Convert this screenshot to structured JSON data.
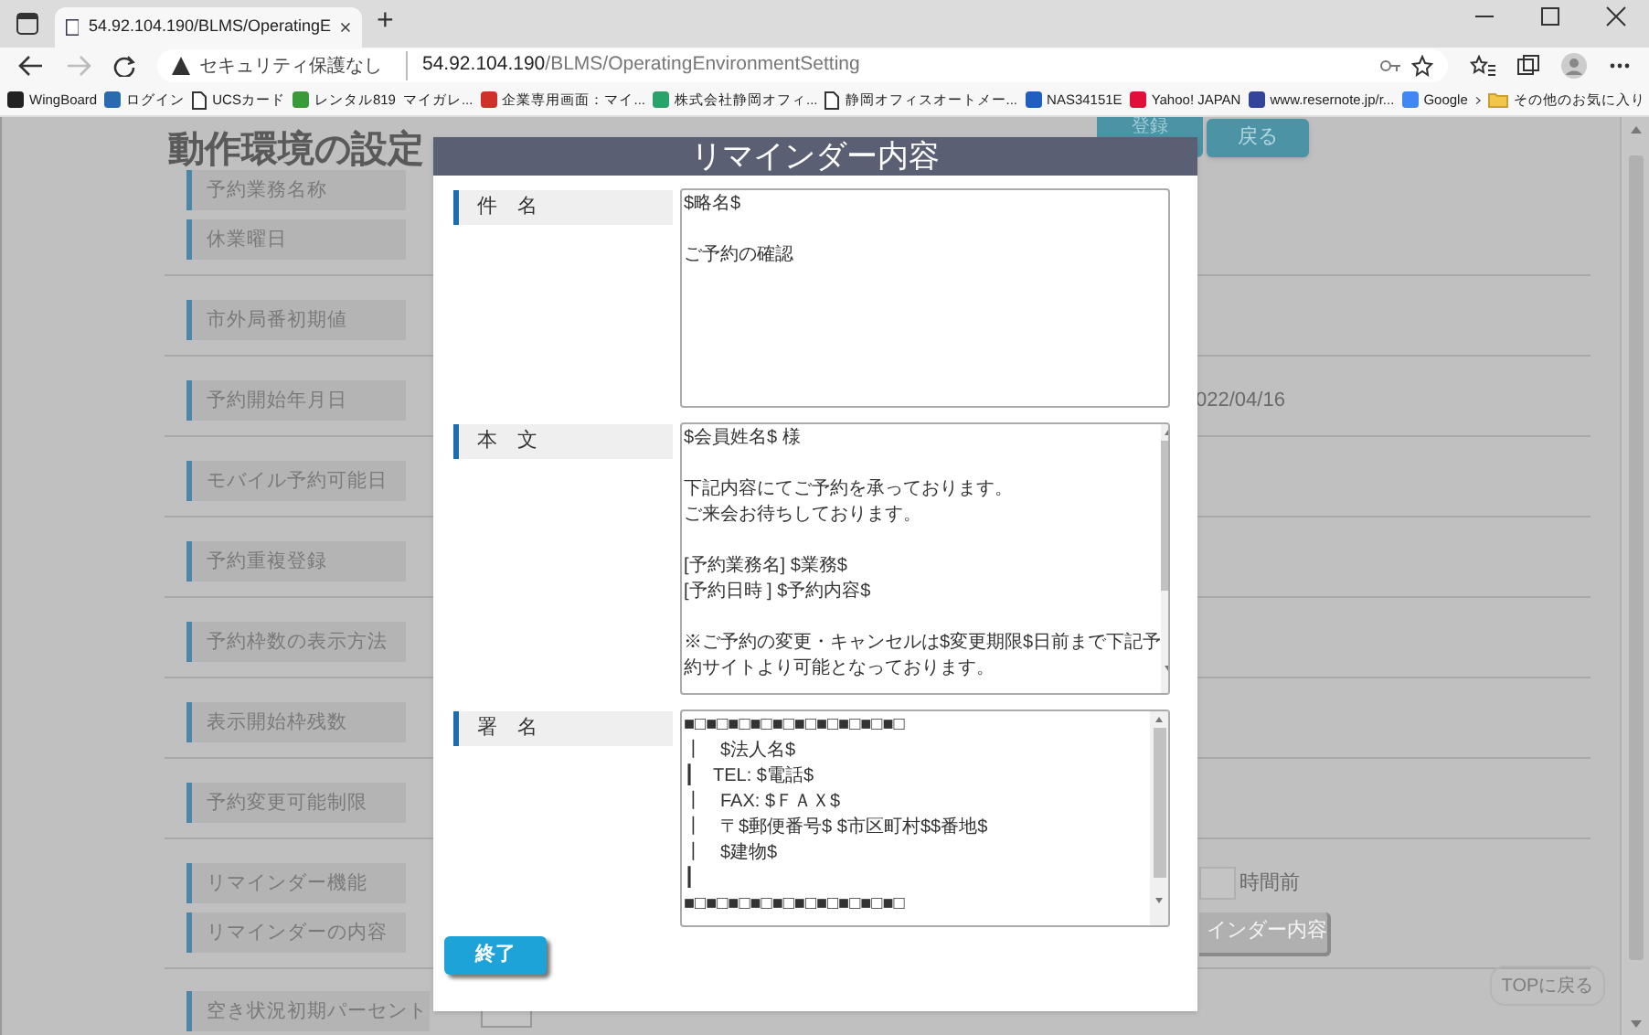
{
  "browser": {
    "tab_title": "54.92.104.190/BLMS/OperatingE",
    "new_tab": "+",
    "security": "セキュリティ保護なし",
    "url_host": "54.92.104.190",
    "url_path": "/BLMS/OperatingEnvironmentSetting",
    "bookmarks": [
      {
        "label": "WingBoard",
        "kind": "tile",
        "color": "#222222"
      },
      {
        "label": "ログイン",
        "kind": "tile",
        "color": "#2a6bb0"
      },
      {
        "label": "UCSカード",
        "kind": "page"
      },
      {
        "label": "レンタル819",
        "kind": "tile",
        "color": "#3a9a3a"
      },
      {
        "label": "マイガレ...",
        "kind": "none"
      },
      {
        "label": "企業専用画面：マイ...",
        "kind": "tile",
        "color": "#d0302a"
      },
      {
        "label": "株式会社静岡オフィ...",
        "kind": "tile",
        "color": "#2aa36a"
      },
      {
        "label": "静岡オフィスオートメー...",
        "kind": "page"
      },
      {
        "label": "NAS34151E",
        "kind": "tile",
        "color": "#1f5fc0"
      },
      {
        "label": "Yahoo! JAPAN",
        "kind": "tile",
        "color": "#e0103a"
      },
      {
        "label": "www.resernote.jp/r...",
        "kind": "tile",
        "color": "#334499"
      },
      {
        "label": "Google",
        "kind": "tile",
        "color": "#4285f4"
      }
    ],
    "other_bookmarks": "その他のお気に入り"
  },
  "page": {
    "title": "動作環境の設定",
    "buttons": [
      "登録",
      "戻る"
    ],
    "groups": [
      {
        "rows": [
          {
            "label": "予約業務名称",
            "kind": "plain"
          },
          {
            "label": "休業曜日",
            "kind": "plain"
          }
        ]
      },
      {
        "rows": [
          {
            "label": "市外局番初期値",
            "kind": "plain"
          }
        ]
      },
      {
        "rows": [
          {
            "label": "予約開始年月日",
            "kind": "date",
            "value": "022/04/16"
          }
        ]
      },
      {
        "rows": [
          {
            "label": "モバイル予約可能日",
            "kind": "plain"
          }
        ]
      },
      {
        "rows": [
          {
            "label": "予約重複登録",
            "kind": "plain"
          }
        ]
      },
      {
        "rows": [
          {
            "label": "予約枠数の表示方法",
            "kind": "plain"
          }
        ]
      },
      {
        "rows": [
          {
            "label": "表示開始枠残数",
            "kind": "plain"
          }
        ]
      },
      {
        "rows": [
          {
            "label": "予約変更可能制限",
            "kind": "plain"
          }
        ]
      },
      {
        "rows": [
          {
            "label": "リマインダー機能",
            "kind": "number_field",
            "suffix": "時間前"
          },
          {
            "label": "リマインダーの内容",
            "kind": "button",
            "button": "インダー内容"
          }
        ]
      },
      {
        "rows": [
          {
            "label": "空き状況初期パーセント",
            "kind": "percent_field"
          }
        ]
      }
    ],
    "top_button": "TOPに戻る"
  },
  "modal": {
    "title": "リマインダー内容",
    "fields": [
      {
        "label": "件　名",
        "scrollable": false,
        "lines": [
          {
            "text": "$略名$",
            "gap_before": false
          },
          {
            "text": "ご予約の確認",
            "gap_before": true
          }
        ]
      },
      {
        "label": "本　文",
        "scrollable": true,
        "lines": [
          {
            "text": "$会員姓名$ 様",
            "gap_before": false
          },
          {
            "text": "下記内容にてご予約を承っております。",
            "gap_before": true
          },
          {
            "text": "ご来会お待ちしております。",
            "gap_before": false
          },
          {
            "text": "[予約業務名] $業務$",
            "gap_before": true
          },
          {
            "text": "[予約日時 ] $予約内容$",
            "gap_before": false
          },
          {
            "text": "※ご予約の変更・キャンセルは$変更期限$日前まで下記予",
            "gap_before": true
          },
          {
            "text": "約サイトより可能となっております。",
            "gap_before": false
          }
        ]
      },
      {
        "label": "署　名",
        "scrollable": true,
        "lines": [
          {
            "text": "■□■□■□■□■□■□■□■□■□■□",
            "gap_before": false
          },
          {
            "text": "┃　$法人名$",
            "gap_before": false
          },
          {
            "text": "┃　TEL: $電話$",
            "gap_before": false
          },
          {
            "text": "┃　FAX: $ＦＡＸ$",
            "gap_before": false
          },
          {
            "text": "┃　〒$郵便番号$ $市区町村$$番地$",
            "gap_before": false
          },
          {
            "text": "┃　$建物$",
            "gap_before": false
          },
          {
            "text": "┃",
            "gap_before": false
          },
          {
            "text": "■□■□■□■□■□■□■□■□■□■□",
            "gap_before": false
          }
        ]
      }
    ],
    "close_button": "終了"
  }
}
